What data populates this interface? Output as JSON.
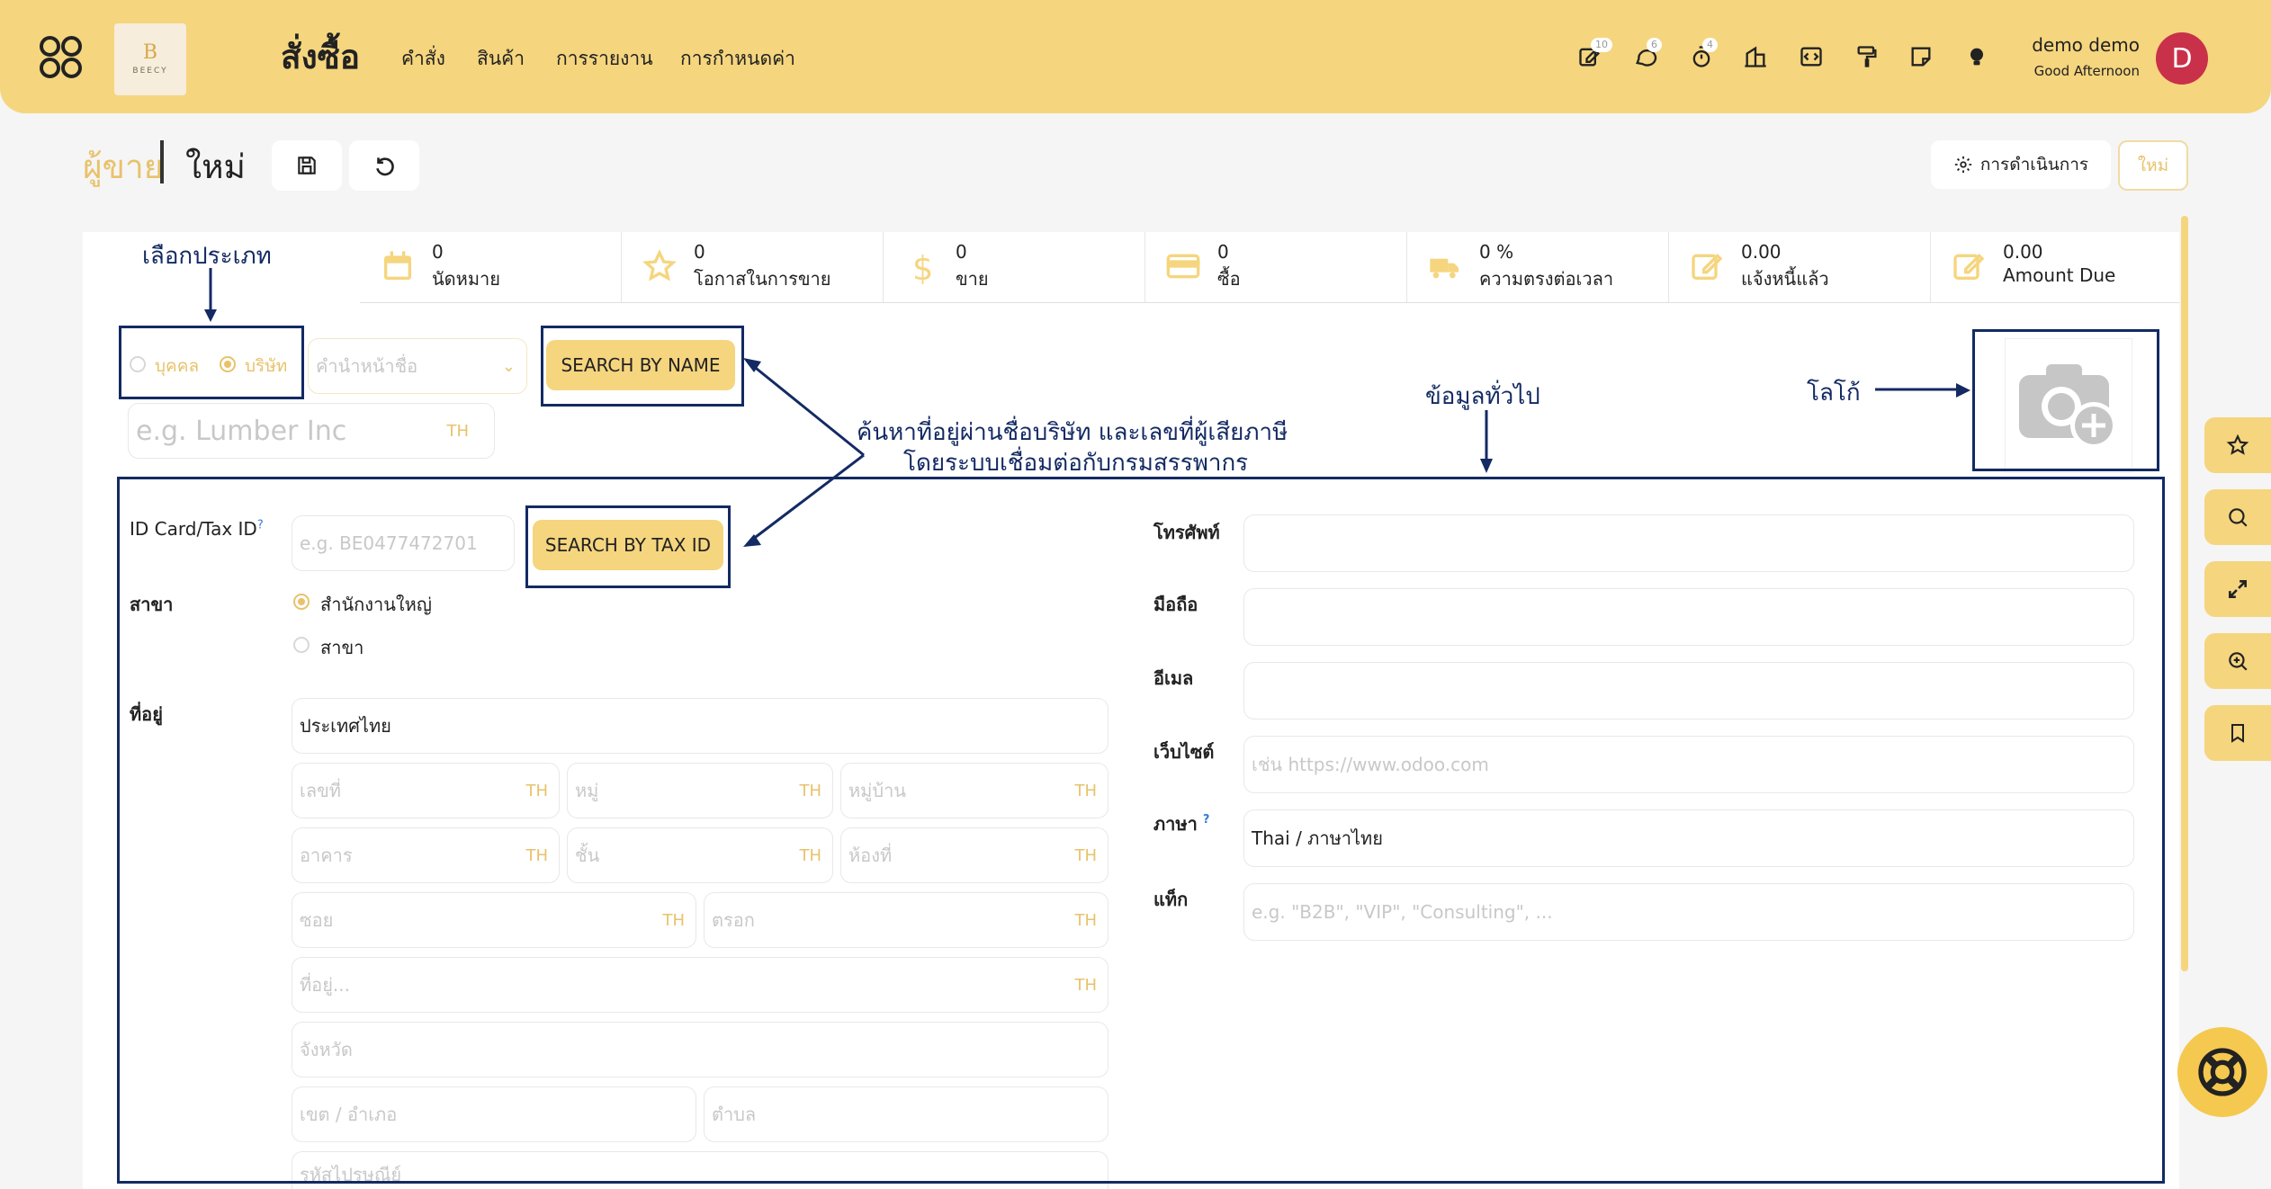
{
  "topbar": {
    "logo_text": "BEECY",
    "app_title": "สั่งซื้อ",
    "menu": [
      "คำสั่ง",
      "สินค้า",
      "การรายงาน",
      "การกำหนดค่า"
    ],
    "badges": {
      "activity": "10",
      "messages": "6",
      "timer": "4"
    },
    "user_name": "demo demo",
    "greeting": "Good Afternoon",
    "avatar_letter": "D"
  },
  "breadcrumb": {
    "parent": "ผู้ขาย",
    "current": "ใหม่"
  },
  "controls": {
    "action_label": "การดำเนินการ",
    "new_label": "ใหม่"
  },
  "stats": [
    {
      "icon": "calendar-icon",
      "value": "0",
      "label": "นัดหมาย"
    },
    {
      "icon": "star-icon",
      "value": "0",
      "label": "โอกาสในการขาย"
    },
    {
      "icon": "dollar-icon",
      "value": "0",
      "label": "ขาย"
    },
    {
      "icon": "credit-card-icon",
      "value": "0",
      "label": "ซื้อ"
    },
    {
      "icon": "truck-icon",
      "value": "0 %",
      "label": "ความตรงต่อเวลา"
    },
    {
      "icon": "edit-icon",
      "value": "0.00",
      "label": "แจ้งหนี้แล้ว"
    },
    {
      "icon": "edit-icon",
      "value": "0.00",
      "label": "Amount Due"
    }
  ],
  "form": {
    "type_person": "บุคคล",
    "type_company": "บริษัท",
    "title_placeholder": "คำนำหน้าชื่อ",
    "name_placeholder": "e.g. Lumber Inc",
    "lang_tag": "TH",
    "search_name_btn": "SEARCH BY NAME",
    "tax_label": "ID Card/Tax ID",
    "tax_help": "?",
    "tax_placeholder": "e.g. BE0477472701",
    "search_tax_btn": "SEARCH BY TAX ID",
    "branch_label": "สาขา",
    "branch_options": [
      "สำนักงานใหญ่",
      "สาขา"
    ],
    "address_label": "ที่อยู่",
    "country": "ประเทศไทย",
    "addr_no": "เลขที่",
    "addr_moo": "หมู่",
    "addr_village": "หมู่บ้าน",
    "addr_building": "อาคาร",
    "addr_floor": "ชั้น",
    "addr_room": "ห้องที่",
    "addr_soi": "ซอย",
    "addr_alley": "ตรอก",
    "addr_street": "ที่อยู่...",
    "addr_province": "จังหวัด",
    "addr_district": "เขต / อำเภอ",
    "addr_subdistrict": "ตำบล",
    "addr_zip": "รหัสไปรษณีย์",
    "phone_label": "โทรศัพท์",
    "mobile_label": "มือถือ",
    "email_label": "อีเมล",
    "website_label": "เว็บไซต์",
    "website_placeholder": "เช่น https://www.odoo.com",
    "language_label": "ภาษา",
    "language_help": "?",
    "language_value": "Thai / ภาษาไทย",
    "tags_label": "แท็ก",
    "tags_placeholder": "e.g. \"B2B\", \"VIP\", \"Consulting\", ..."
  },
  "annotations": {
    "select_type": "เลือกประเภท",
    "search_note_1": "ค้นหาที่อยู่ผ่านชื่อบริษัท และเลขที่ผู้เสียภาษี",
    "search_note_2": "โดยระบบเชื่อมต่อกับกรมสรรพากร",
    "general_info": "ข้อมูลทั่วไป",
    "logo": "โลโก้"
  },
  "colors": {
    "brand_yellow": "#f5d57e",
    "accent_gold": "#e8c26b",
    "annotation_blue": "#132a63",
    "avatar_red": "#c9304a"
  }
}
